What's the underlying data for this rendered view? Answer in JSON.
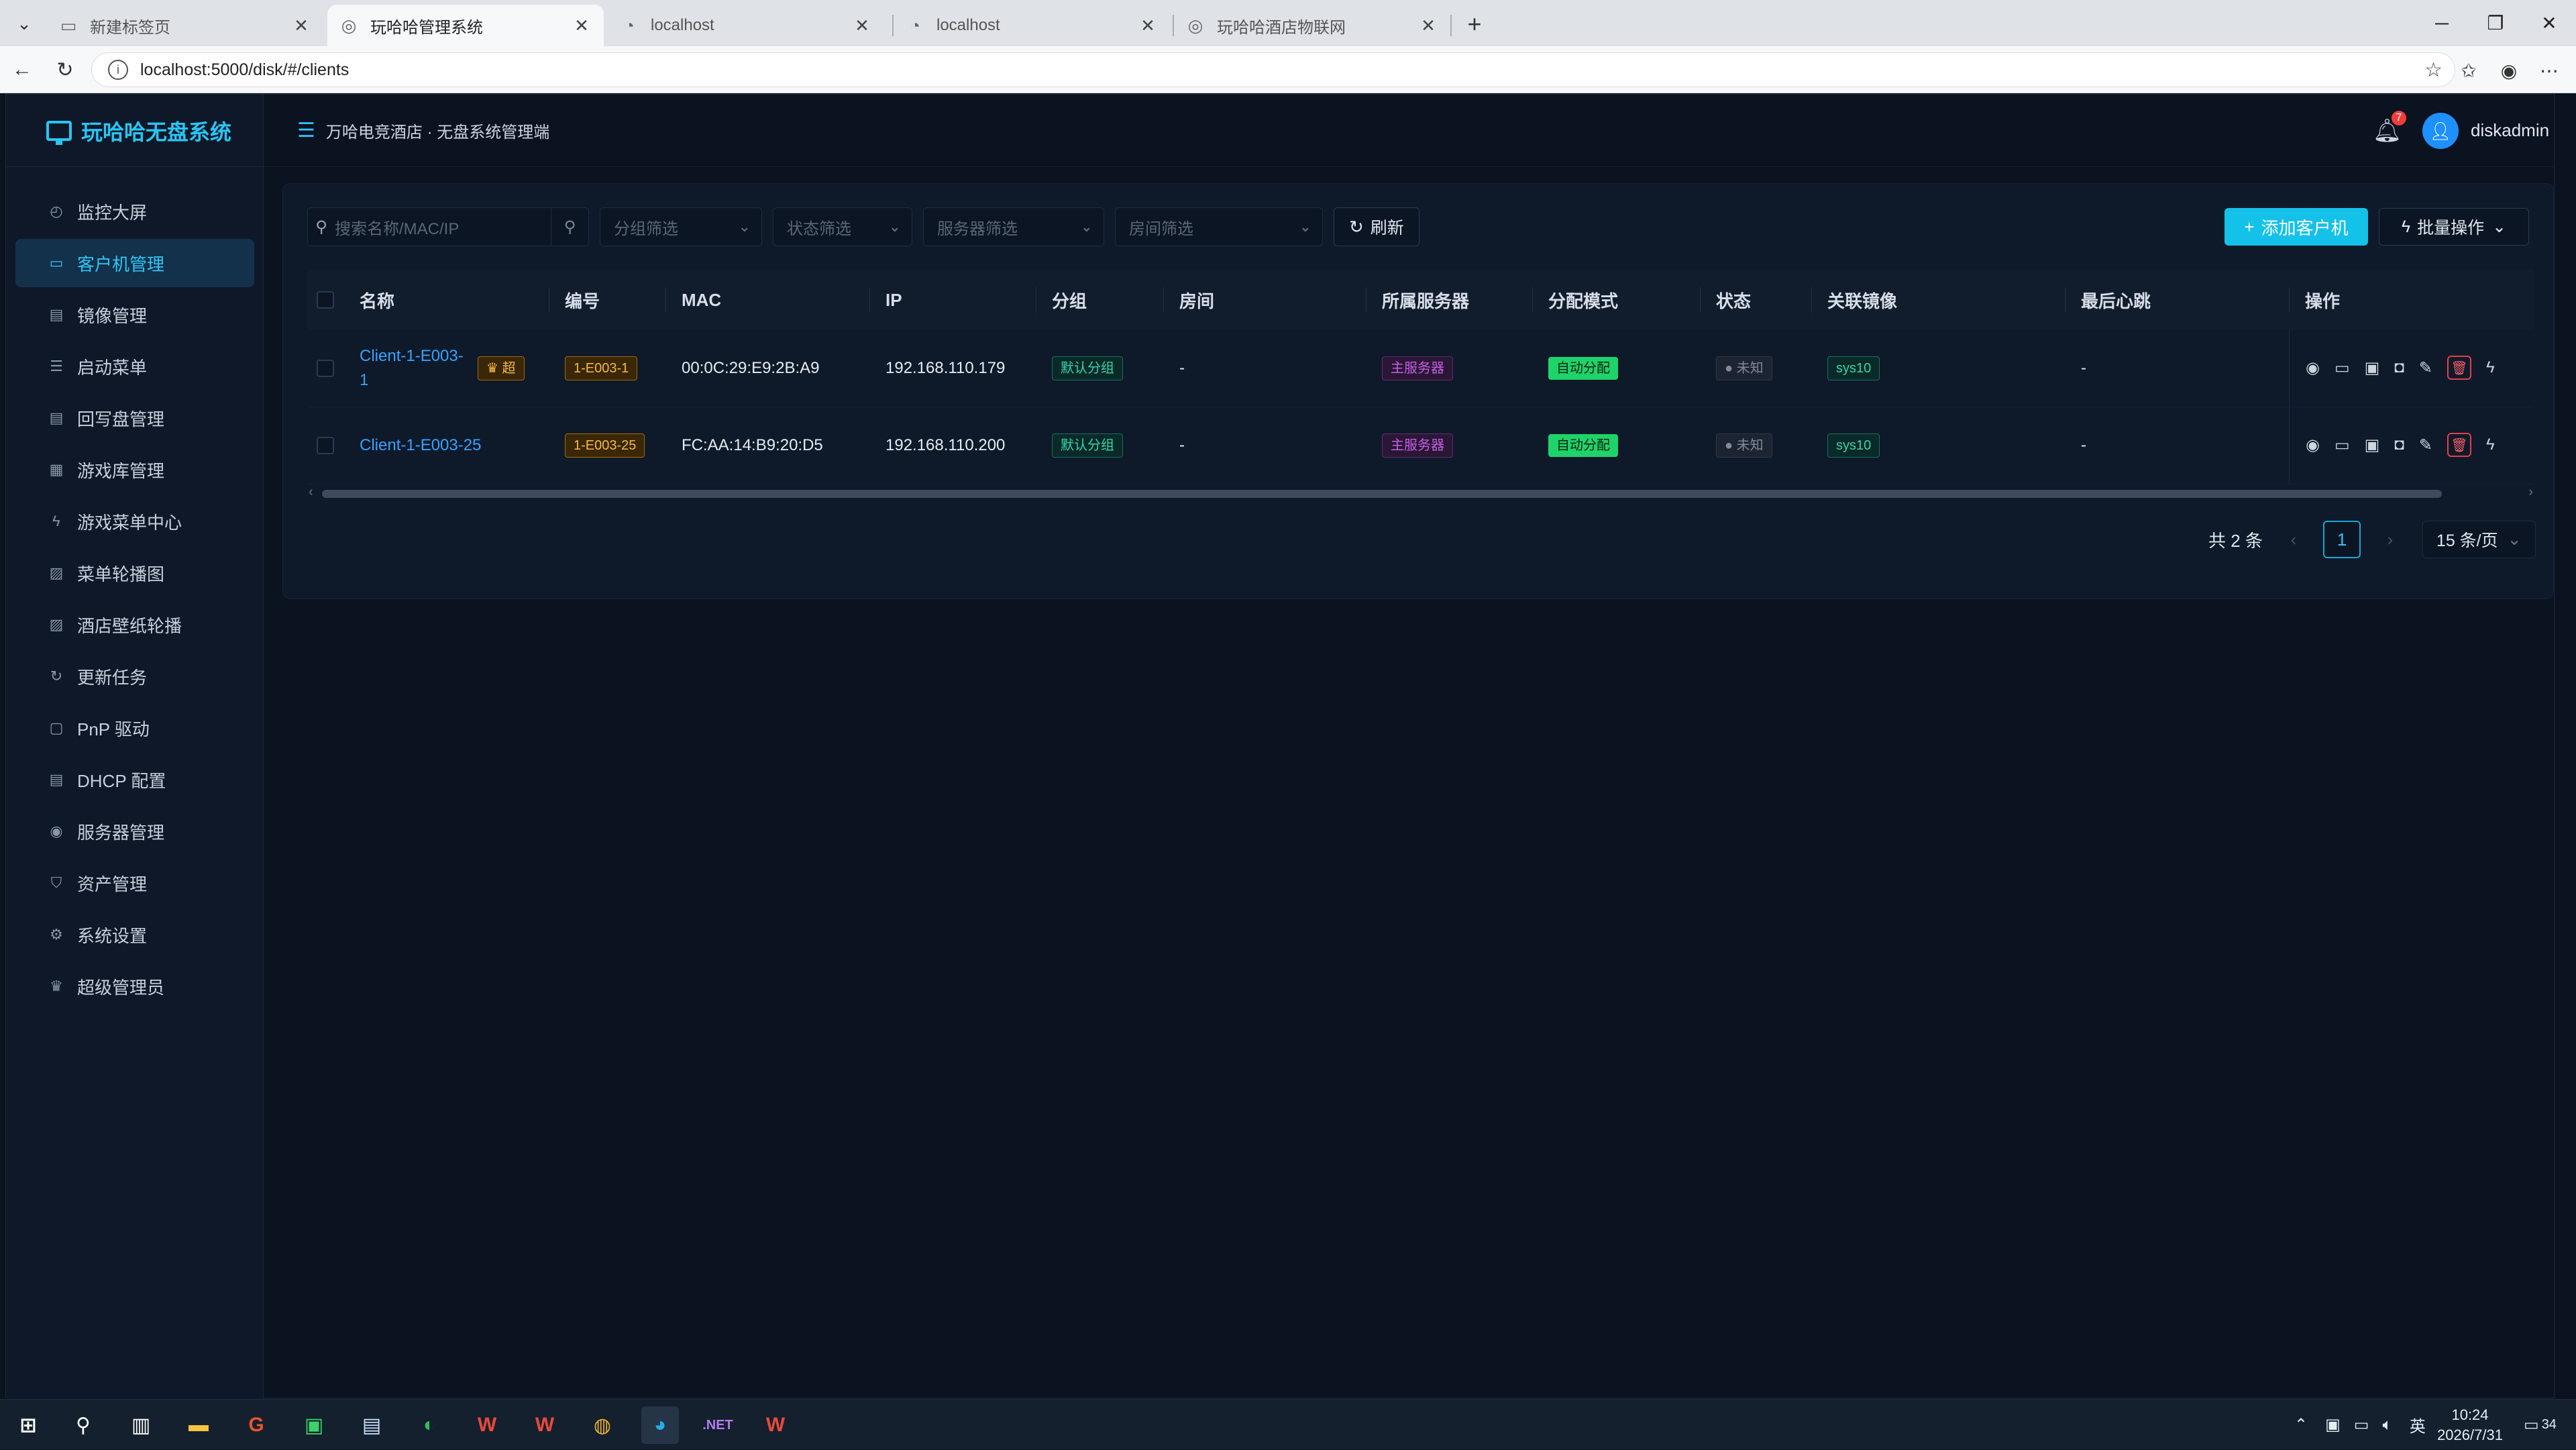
{
  "browser": {
    "tabs": [
      {
        "label": "新建标签页",
        "icon": "new-tab-page-icon"
      },
      {
        "label": "玩哈哈管理系统",
        "icon": "globe-icon"
      },
      {
        "label": "localhost",
        "icon": "page-icon"
      },
      {
        "label": "localhost",
        "icon": "page-icon"
      },
      {
        "label": "玩哈哈酒店物联网",
        "icon": "globe-icon"
      }
    ],
    "url": "localhost:5000/disk/#/clients"
  },
  "app": {
    "brand": "玩哈哈无盘系统",
    "breadcrumb": "万哈电竞酒店 · 无盘系统管理端",
    "notification_count": "7",
    "username": "diskadmin"
  },
  "sidebar": {
    "items": [
      {
        "label": "监控大屏",
        "icon": "dashboard-icon"
      },
      {
        "label": "客户机管理",
        "icon": "monitor-icon",
        "active": true
      },
      {
        "label": "镜像管理",
        "icon": "image-icon"
      },
      {
        "label": "启动菜单",
        "icon": "list-icon"
      },
      {
        "label": "回写盘管理",
        "icon": "disk-icon"
      },
      {
        "label": "游戏库管理",
        "icon": "grid-icon"
      },
      {
        "label": "游戏菜单中心",
        "icon": "bolt-icon"
      },
      {
        "label": "菜单轮播图",
        "icon": "picture-icon"
      },
      {
        "label": "酒店壁纸轮播",
        "icon": "picture-icon"
      },
      {
        "label": "更新任务",
        "icon": "refresh-icon"
      },
      {
        "label": "PnP 驱动",
        "icon": "driver-icon"
      },
      {
        "label": "DHCP 配置",
        "icon": "network-icon"
      },
      {
        "label": "服务器管理",
        "icon": "eye-icon"
      },
      {
        "label": "资产管理",
        "icon": "shield-icon"
      },
      {
        "label": "系统设置",
        "icon": "gear-icon"
      },
      {
        "label": "超级管理员",
        "icon": "crown-icon"
      }
    ]
  },
  "filters": {
    "search_placeholder": "搜索名称/MAC/IP",
    "group_placeholder": "分组筛选",
    "status_placeholder": "状态筛选",
    "server_placeholder": "服务器筛选",
    "room_placeholder": "房间筛选",
    "refresh_label": "刷新",
    "add_label": "添加客户机",
    "batch_label": "批量操作"
  },
  "table": {
    "headers": [
      "名称",
      "编号",
      "MAC",
      "IP",
      "分组",
      "房间",
      "所属服务器",
      "分配模式",
      "状态",
      "关联镜像",
      "最后心跳",
      "操作"
    ],
    "rows": [
      {
        "name": "Client-1-E003-1",
        "super": "超",
        "code": "1-E003-1",
        "mac": "00:0C:29:E9:2B:A9",
        "ip": "192.168.110.179",
        "group": "默认分组",
        "room": "-",
        "server": "主服务器",
        "mode": "自动分配",
        "status": "未知",
        "image": "sys10",
        "heartbeat": "-"
      },
      {
        "name": "Client-1-E003-25",
        "super": "",
        "code": "1-E003-25",
        "mac": "FC:AA:14:B9:20:D5",
        "ip": "192.168.110.200",
        "group": "默认分组",
        "room": "-",
        "server": "主服务器",
        "mode": "自动分配",
        "status": "未知",
        "image": "sys10",
        "heartbeat": "-"
      }
    ]
  },
  "pagination": {
    "total": "共 2 条",
    "current_page": "1",
    "page_size": "15 条/页"
  },
  "taskbar": {
    "time": "10:24",
    "date": "2026/7/31",
    "ime": "英",
    "notif_count": "34"
  },
  "colors": {
    "accent": "#14c1e8",
    "background": "#0b1220",
    "sidebar": "#0e1828",
    "link": "#3aa0ff",
    "auto_tag": "#1ed36a"
  }
}
